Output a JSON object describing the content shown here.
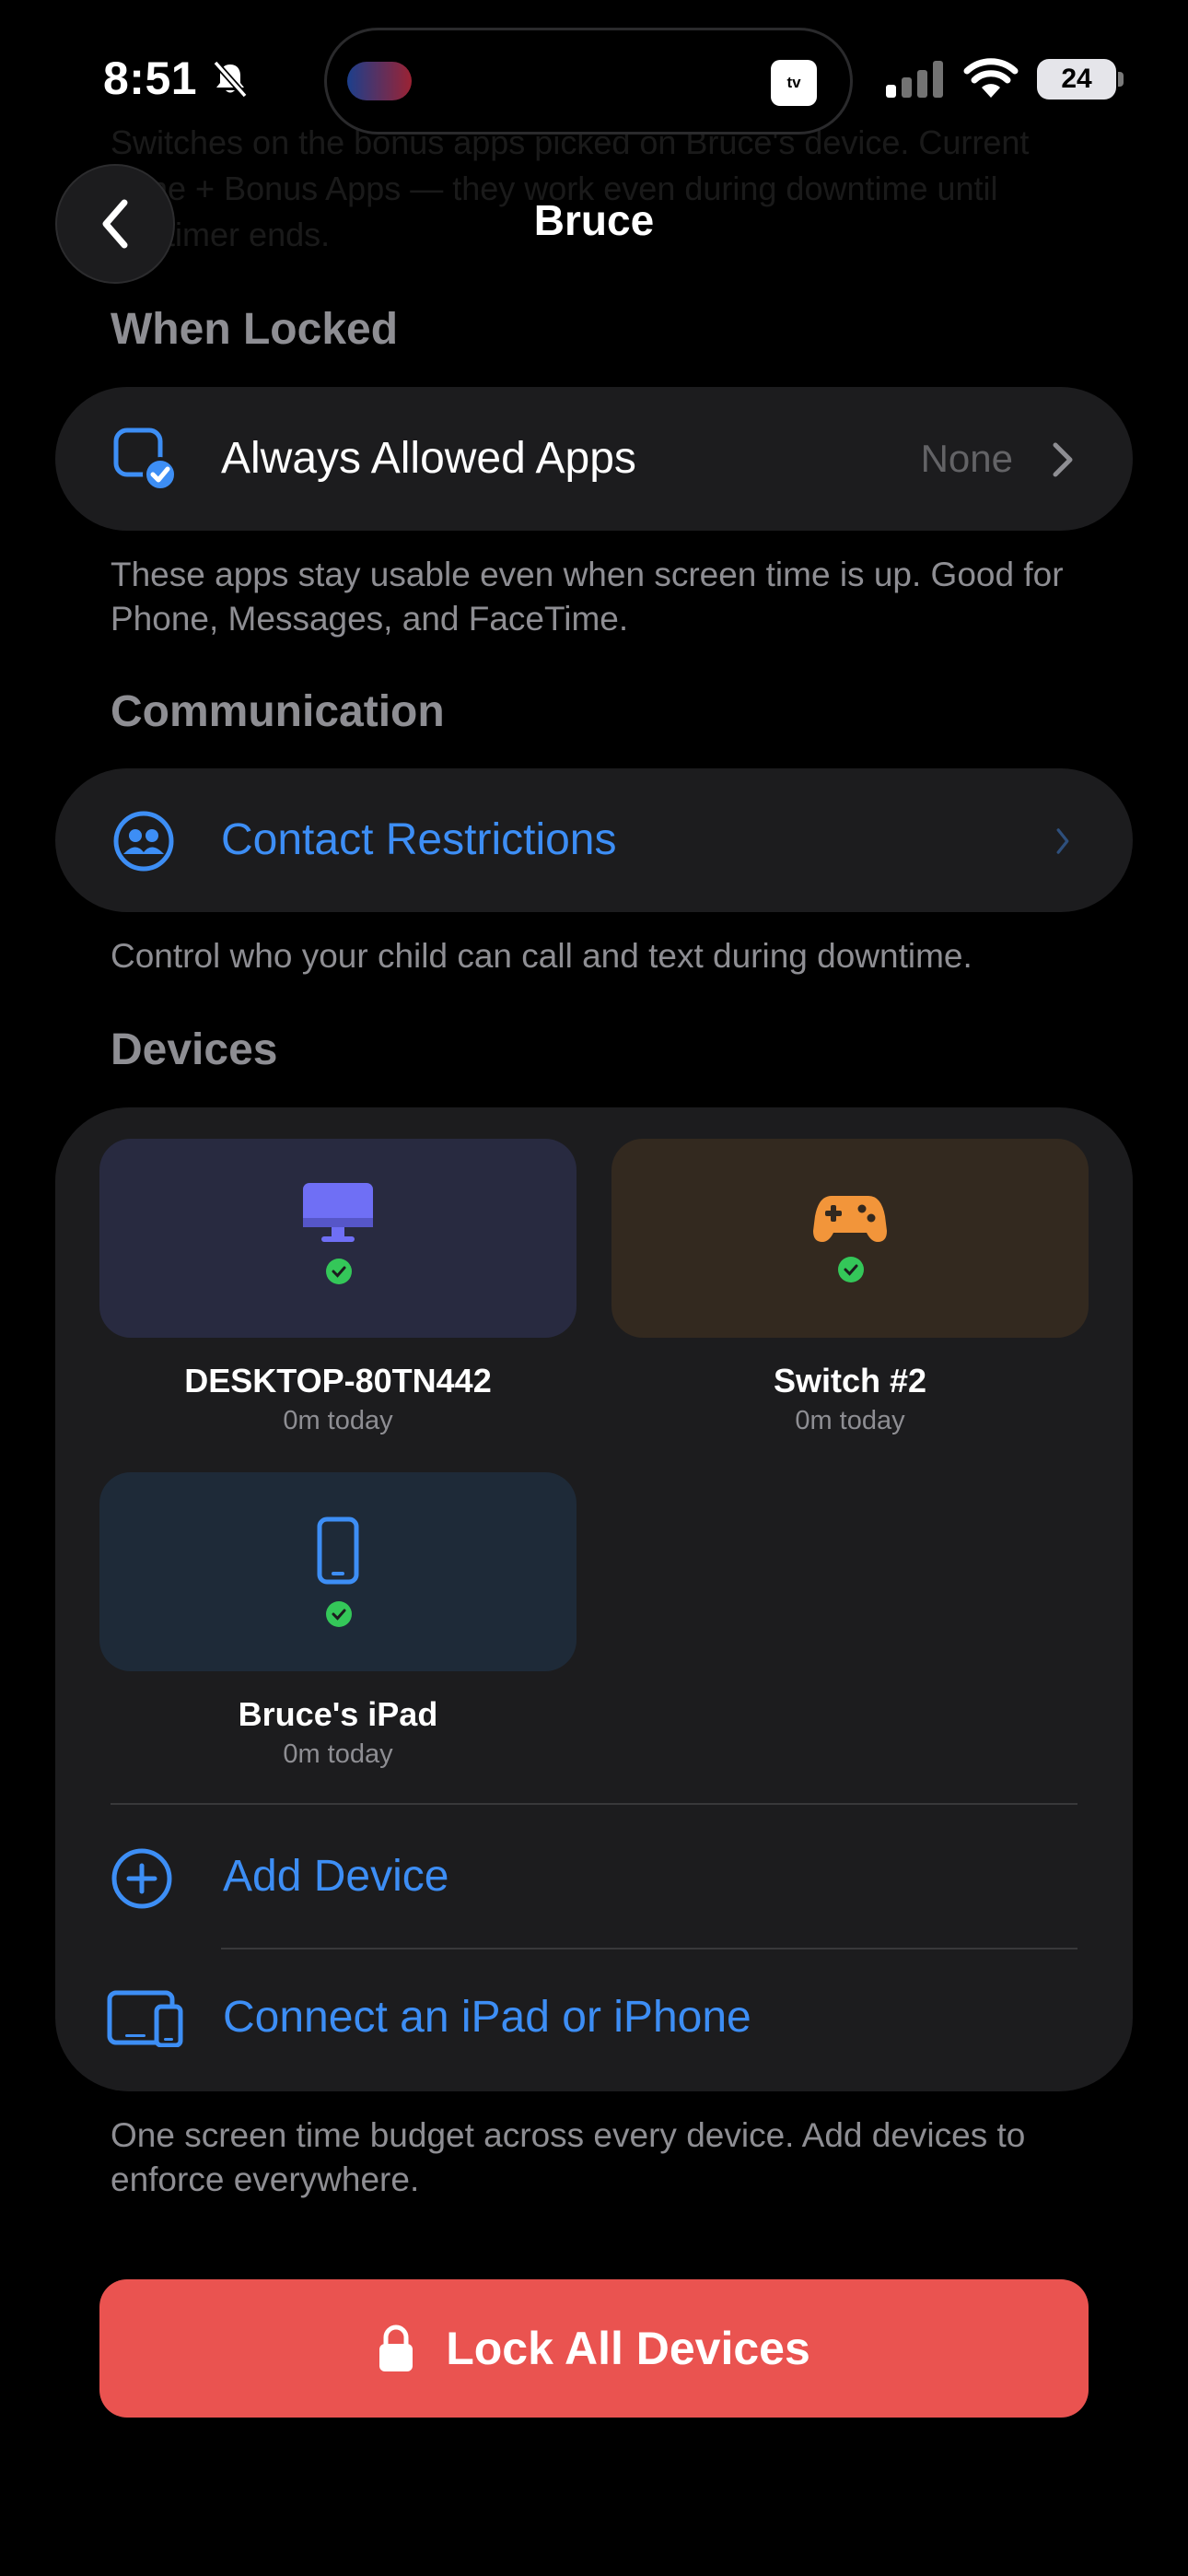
{
  "status_bar": {
    "time": "8:51",
    "battery": "24",
    "live_activity_badge": "tv",
    "icons": [
      "bell-slash-icon",
      "cellular-signal-icon",
      "wifi-icon",
      "battery-icon"
    ]
  },
  "nav": {
    "title": "Bruce",
    "back_icon": "chevron-left-icon"
  },
  "scrolled_text": "Switches on the bonus apps picked on Bruce's device. Current Zone + Bonus Apps — they work even during downtime until the timer ends.",
  "when_locked": {
    "header": "When Locked",
    "row_label": "Always Allowed Apps",
    "row_value": "None",
    "icon": "app-checkmark-icon",
    "footnote": "These apps stay usable even when screen time is up. Good for Phone, Messages, and FaceTime."
  },
  "communication": {
    "header": "Communication",
    "row_label": "Contact Restrictions",
    "icon": "contacts-icon",
    "footnote": "Control who your child can call and text during downtime."
  },
  "devices": {
    "header": "Devices",
    "items": [
      {
        "name": "DESKTOP-80TN442",
        "usage": "0m today",
        "icon": "desktop-icon",
        "tile_color": "#282a40",
        "icon_color": "#6f6ff5"
      },
      {
        "name": "Switch #2",
        "usage": "0m today",
        "icon": "gamepad-icon",
        "tile_color": "#33291f",
        "icon_color": "#f2953a"
      },
      {
        "name": "Bruce's iPad",
        "usage": "0m today",
        "icon": "ipad-icon",
        "tile_color": "#1e2a38",
        "icon_color": "#3d8ef5"
      }
    ],
    "add_device_label": "Add Device",
    "connect_label": "Connect an iPad or iPhone",
    "footnote": "One screen time budget across every device. Add devices to enforce everywhere."
  },
  "lock_button": {
    "label": "Lock All Devices",
    "icon": "lock-icon"
  },
  "colors": {
    "accent": "#3d8ef5",
    "danger": "#ea5350",
    "success": "#34c759",
    "card": "#1c1c1e",
    "secondary_text": "#8e8e93"
  }
}
